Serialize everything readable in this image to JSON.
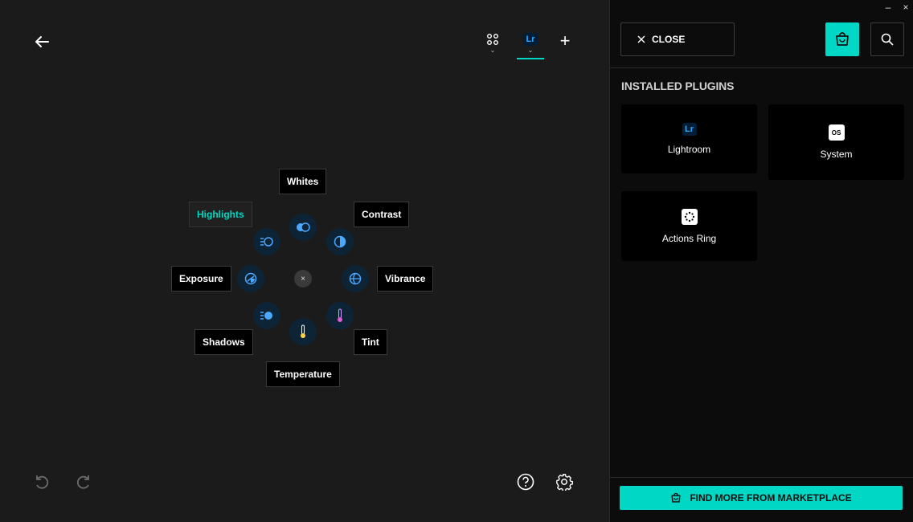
{
  "toolbar": {
    "back_icon": "arrow-left-icon",
    "apps_icon": "grid-icon",
    "profile_badge": "Lr",
    "add_icon": "plus-icon",
    "add_label": "+"
  },
  "ring": {
    "center_label": "×",
    "labels": {
      "whites": "Whites",
      "highlights": "Highlights",
      "contrast": "Contrast",
      "exposure": "Exposure",
      "vibrance": "Vibrance",
      "shadows": "Shadows",
      "tint": "Tint",
      "temperature": "Temperature"
    },
    "active": "Highlights",
    "colors": {
      "accent": "#00d7c4",
      "icon_blue": "#4aa8ff",
      "button_bg": "#0d2436"
    }
  },
  "footer": {
    "undo_icon": "undo-icon",
    "redo_icon": "redo-icon",
    "help_icon": "help-icon",
    "settings_icon": "gear-icon"
  },
  "panel": {
    "window_controls": {
      "minimize": "–",
      "close": "×"
    },
    "close_label": "CLOSE",
    "section_title": "INSTALLED PLUGINS",
    "plugins": [
      {
        "name": "Lightroom",
        "badge": "Lr"
      },
      {
        "name": "System",
        "badge": "OS"
      },
      {
        "name": "Actions Ring",
        "badge": ""
      }
    ],
    "marketplace_label": "FIND MORE FROM MARKETPLACE",
    "colors": {
      "accent": "#00d7c4"
    }
  }
}
